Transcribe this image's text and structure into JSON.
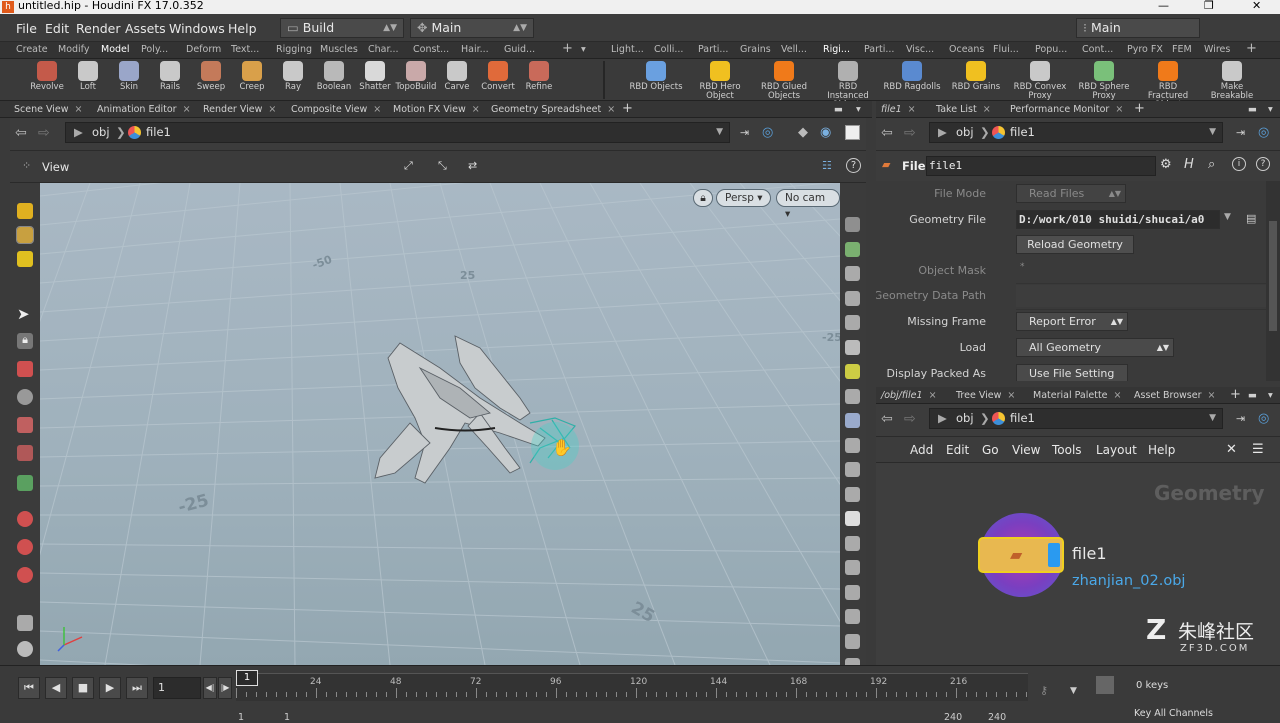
{
  "title": "untitled.hip - Houdini FX 17.0.352",
  "menus": [
    "File",
    "Edit",
    "Render",
    "Assets",
    "Windows",
    "Help"
  ],
  "desktop": "Build",
  "context": "Main",
  "desktop_right": "Main",
  "shelf_tabs_left": [
    "Create",
    "Modify",
    "Model",
    "Poly...",
    "Deform",
    "Text...",
    "Rigging",
    "Muscles",
    "Char...",
    "Const...",
    "Hair...",
    "Guid..."
  ],
  "shelf_tabs_right": [
    "Light...",
    "Colli...",
    "Parti...",
    "Grains",
    "Vell...",
    "Rigi...",
    "Parti...",
    "Visc...",
    "Oceans",
    "Flui...",
    "Popu...",
    "Cont...",
    "Pyro FX",
    "FEM",
    "Wires"
  ],
  "tools_left": [
    {
      "l": "Revolve",
      "c": "#c45a4a"
    },
    {
      "l": "Loft",
      "c": "#c9c9c9"
    },
    {
      "l": "Skin",
      "c": "#9aa6c9"
    },
    {
      "l": "Rails",
      "c": "#c9c9c9"
    },
    {
      "l": "Sweep",
      "c": "#c47a5a"
    },
    {
      "l": "Creep",
      "c": "#d9a04a"
    },
    {
      "l": "Ray",
      "c": "#c9c9c9"
    },
    {
      "l": "Boolean",
      "c": "#b9b9b9"
    },
    {
      "l": "Shatter",
      "c": "#d9d9d9"
    },
    {
      "l": "TopoBuild",
      "c": "#c9a9a9"
    },
    {
      "l": "Carve",
      "c": "#c9c9c9"
    },
    {
      "l": "Convert",
      "c": "#e06a3a"
    },
    {
      "l": "Refine",
      "c": "#c96a5a"
    }
  ],
  "tools_right": [
    {
      "l": "RBD Objects",
      "c": "#6aa0e0"
    },
    {
      "l": "RBD Hero Object",
      "c": "#f0c020"
    },
    {
      "l": "RBD Glued Objects",
      "c": "#f07a1a"
    },
    {
      "l": "RBD Instanced Objects",
      "c": "#b0b0b0"
    },
    {
      "l": "RBD Ragdolls",
      "c": "#5a8ad0"
    },
    {
      "l": "RBD Grains",
      "c": "#f0c020"
    },
    {
      "l": "RBD Convex Proxy",
      "c": "#c9c9c9"
    },
    {
      "l": "RBD Sphere Proxy",
      "c": "#7ac07a"
    },
    {
      "l": "RBD Fractured Object",
      "c": "#f07a1a"
    },
    {
      "l": "Make Breakable",
      "c": "#c9c9c9"
    }
  ],
  "panel_tabs": [
    "Scene View",
    "Animation Editor",
    "Render View",
    "Composite View",
    "Motion FX View",
    "Geometry Spreadsheet"
  ],
  "path": {
    "root": "obj",
    "node": "file1"
  },
  "view": {
    "label": "View",
    "persp": "Persp",
    "cam": "No cam",
    "grid_labels": [
      "-25",
      "25",
      "-50",
      "-25",
      "25"
    ]
  },
  "timeline": {
    "frame": "1",
    "ticks": [
      "24",
      "48",
      "72",
      "96",
      "120",
      "144",
      "168",
      "192",
      "216"
    ],
    "start": "1",
    "start2": "1",
    "end": "240",
    "end2": "240",
    "key_label": "Key All Channels",
    "frame_label": "0 keys"
  },
  "parm_tabs": [
    "file1",
    "Take List",
    "Performance Monitor"
  ],
  "parm_header": {
    "type": "File",
    "name": "file1"
  },
  "parms": [
    {
      "label": "File Mode",
      "value": "Read Files",
      "dim": true
    },
    {
      "label": "Geometry File",
      "value": "D:/work/010 shuidi/shucai/a0",
      "dim": false
    },
    {
      "label": "",
      "value": "Reload Geometry",
      "dim": false
    },
    {
      "label": "Object Mask",
      "value": "*",
      "dim": true
    },
    {
      "label": "Geometry Data Path",
      "value": "",
      "dim": true
    },
    {
      "label": "Missing Frame",
      "value": "Report Error",
      "dim": false
    },
    {
      "label": "Load",
      "value": "All Geometry",
      "dim": false
    },
    {
      "label": "Display Packed As",
      "value": "Use File Setting",
      "dim": false
    }
  ],
  "net_tabs": [
    "/obj/file1",
    "Tree View",
    "Material Palette",
    "Asset Browser"
  ],
  "net_menus": [
    "Add",
    "Edit",
    "Go",
    "View",
    "Tools",
    "Layout",
    "Help"
  ],
  "network": {
    "context_label": "Geometry",
    "node_name": "file1",
    "node_file": "zhanjian_02.obj"
  },
  "watermark": {
    "cn": "朱峰社区",
    "url": "ZF3D.COM"
  }
}
